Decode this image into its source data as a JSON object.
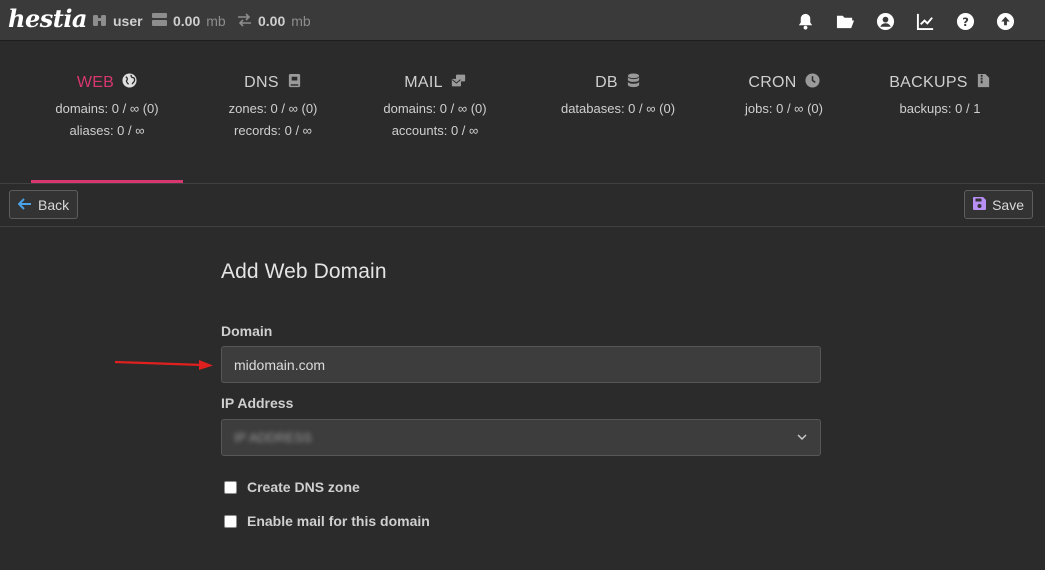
{
  "brand": {
    "logo_text": "hestia"
  },
  "header": {
    "user": "user",
    "disk_value": "0.00",
    "disk_unit": "mb",
    "bandwidth_value": "0.00",
    "bandwidth_unit": "mb",
    "icons": [
      "bell-icon",
      "folder-open-icon",
      "user-circle-icon",
      "chart-line-icon",
      "help-icon",
      "upload-icon"
    ]
  },
  "tabs": [
    {
      "title": "WEB",
      "icon": "globe-icon",
      "lines": [
        "domains: 0 / ∞ (0)",
        "aliases: 0 / ∞"
      ],
      "active": true
    },
    {
      "title": "DNS",
      "icon": "book-icon",
      "lines": [
        "zones: 0 / ∞ (0)",
        "records: 0 / ∞"
      ],
      "active": false
    },
    {
      "title": "MAIL",
      "icon": "mail-bulk-icon",
      "lines": [
        "domains: 0 / ∞ (0)",
        "accounts: 0 / ∞"
      ],
      "active": false
    },
    {
      "title": "DB",
      "icon": "database-icon",
      "lines": [
        "databases: 0 / ∞ (0)"
      ],
      "active": false
    },
    {
      "title": "CRON",
      "icon": "clock-icon",
      "lines": [
        "jobs: 0 / ∞ (0)"
      ],
      "active": false
    },
    {
      "title": "BACKUPS",
      "icon": "file-archive-icon",
      "lines": [
        "backups: 0 / 1"
      ],
      "active": false
    }
  ],
  "toolbar": {
    "back_label": "Back",
    "save_label": "Save"
  },
  "form": {
    "title": "Add Web Domain",
    "domain_label": "Domain",
    "domain_value": "midomain.com",
    "ip_label": "IP Address",
    "ip_value": "IP ADDRESS",
    "dns_checkbox_label": "Create DNS zone",
    "mail_checkbox_label": "Enable mail for this domain"
  },
  "colors": {
    "accent": "#d8366f",
    "save_icon": "#b88ff5",
    "back_icon": "#4aa3e8",
    "arrow": "#e0201f"
  }
}
